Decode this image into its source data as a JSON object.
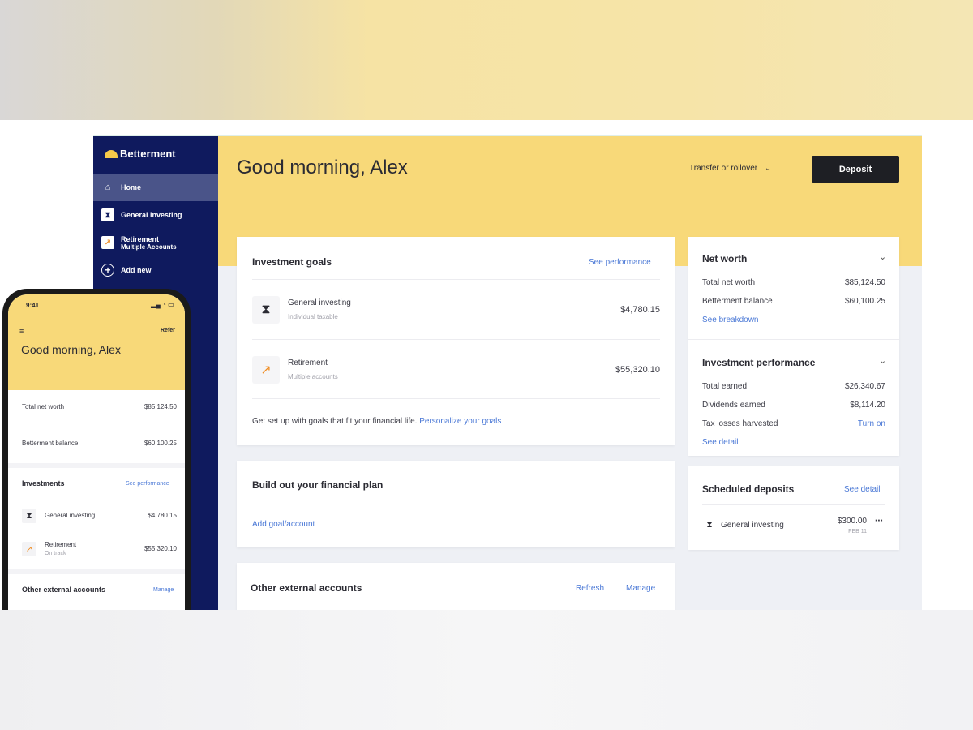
{
  "brand": {
    "name": "Betterment",
    "accent": "#f8d979",
    "navy": "#0f1a5e",
    "link": "#4a78d6"
  },
  "sidebar": {
    "items": [
      {
        "label": "Home",
        "icon": "home-icon"
      },
      {
        "label": "General investing",
        "icon": "general-investing-icon"
      },
      {
        "label": "Retirement",
        "sub": "Multiple Accounts",
        "icon": "retirement-icon"
      },
      {
        "label": "Add new",
        "icon": "plus-circle-icon"
      }
    ]
  },
  "header": {
    "greeting": "Good morning, Alex",
    "transfer_label": "Transfer or rollover",
    "deposit_label": "Deposit"
  },
  "investment_goals": {
    "title": "Investment goals",
    "link": "See performance",
    "goals": [
      {
        "name": "General investing",
        "sub": "Individual taxable",
        "value": "$4,780.15",
        "icon": "general-investing-icon"
      },
      {
        "name": "Retirement",
        "sub": "Multiple accounts",
        "value": "$55,320.10",
        "icon": "retirement-icon"
      }
    ],
    "footer_text": "Get set up with goals that fit your financial life.",
    "footer_link": "Personalize your goals"
  },
  "financial_plan": {
    "title": "Build out your financial plan",
    "link": "Add goal/account"
  },
  "external_accounts": {
    "title": "Other external accounts",
    "refresh": "Refresh",
    "manage": "Manage"
  },
  "net_worth": {
    "title": "Net worth",
    "rows": [
      {
        "label": "Total net worth",
        "value": "$85,124.50"
      },
      {
        "label": "Betterment balance",
        "value": "$60,100.25"
      }
    ],
    "link": "See breakdown"
  },
  "performance": {
    "title": "Investment performance",
    "rows": [
      {
        "label": "Total earned",
        "value": "$26,340.67"
      },
      {
        "label": "Dividends earned",
        "value": "$8,114.20"
      },
      {
        "label": "Tax losses harvested",
        "value": "Turn on"
      }
    ],
    "link": "See detail"
  },
  "scheduled": {
    "title": "Scheduled deposits",
    "link": "See detail",
    "item": {
      "name": "General investing",
      "amount": "$300.00",
      "date": "FEB 11"
    }
  },
  "phone": {
    "time": "9:41",
    "refer": "Refer",
    "greeting": "Good morning, Alex",
    "total_label": "Total net worth",
    "total_value": "$85,124.50",
    "balance_label": "Betterment balance",
    "balance_value": "$60,100.25",
    "investments_title": "Investments",
    "investments_link": "See performance",
    "items": [
      {
        "name": "General investing",
        "value": "$4,780.15"
      },
      {
        "name": "Retirement",
        "sub": "On track",
        "value": "$55,320.10"
      }
    ],
    "external_title": "Other external accounts",
    "external_link": "Manage"
  }
}
